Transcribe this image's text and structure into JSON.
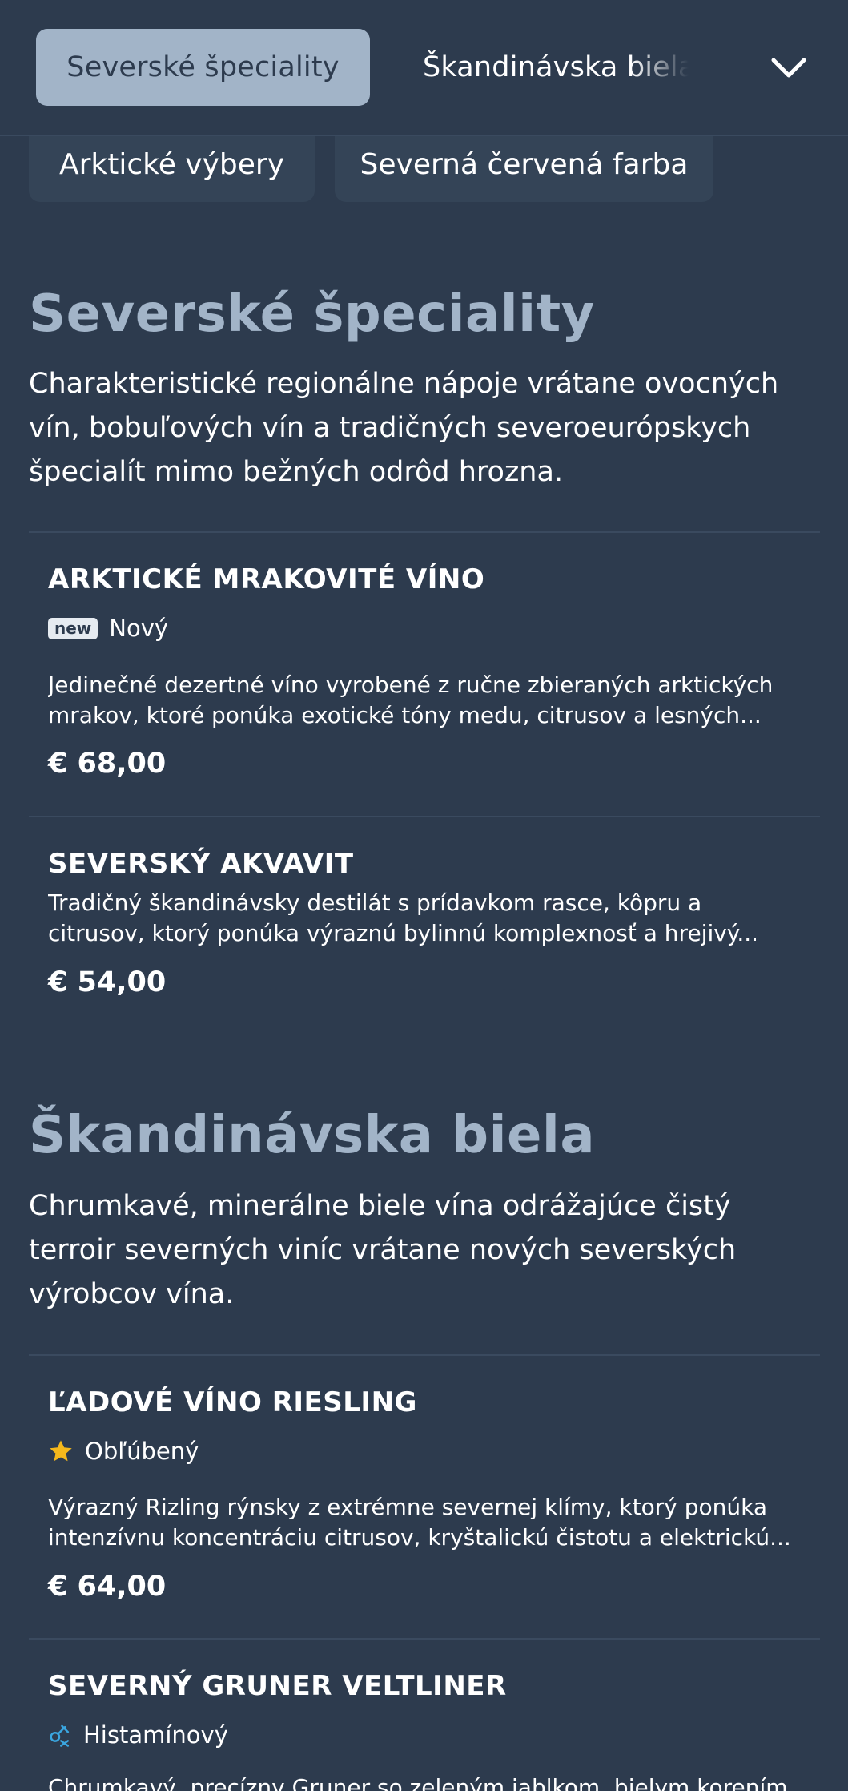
{
  "nav": {
    "active_category": "Severské špeciality",
    "next_category": "Škandinávska biela",
    "expand_icon": "chevron-down-icon"
  },
  "subnav": {
    "items": [
      "Arktické výbery",
      "Severná červená farba"
    ]
  },
  "sections": [
    {
      "title": "Severské špeciality",
      "description": "Charakteristické regionálne nápoje vrátane ovocných vín, bobuľových vín a tradičných severoeurópskych špecialít mimo bežných odrôd hrozna.",
      "items": [
        {
          "name": "ARKTICKÉ MRAKOVITÉ VÍNO",
          "badge_tag": "new",
          "badge_label": "Nový",
          "description": "Jedinečné dezertné víno vyrobené z ručne zbieraných arktických mrakov, ktoré ponúka exotické tóny medu, citrusov a lesných...",
          "price": "€ 68,00"
        },
        {
          "name": "SEVERSKÝ AKVAVIT",
          "description": "Tradičný škandinávsky destilát s prídavkom rasce, kôpru a citrusov, ktorý ponúka výraznú bylinnú komplexnosť a hrejivý...",
          "price": "€ 54,00"
        }
      ]
    },
    {
      "title": "Škandinávska biela",
      "description": "Chrumkavé, minerálne biele vína odrážajúce čistý terroir severných viníc vrátane nových severských výrobcov vína.",
      "items": [
        {
          "name": "ĽADOVÉ VÍNO RIESLING",
          "badge_icon": "star-icon",
          "badge_label": "Obľúbený",
          "description": "Výrazný Rizling rýnsky z extrémne severnej klímy, ktorý ponúka intenzívnu koncentráciu citrusov, kryštalickú čistotu a elektrickú...",
          "price": "€ 64,00"
        },
        {
          "name": "SEVERNÝ GRUNER VELTLINER",
          "badge_icon": "histamine-icon",
          "badge_label": "Histamínový",
          "description": "Chrumkavý, precízny Gruner so zeleným jablkom, bielym korením",
          "price": ""
        }
      ]
    }
  ],
  "colors": {
    "background": "#2d3b4e",
    "accent": "#a2b4c8",
    "star": "#f5b81c",
    "histamine": "#3aa6e0"
  }
}
